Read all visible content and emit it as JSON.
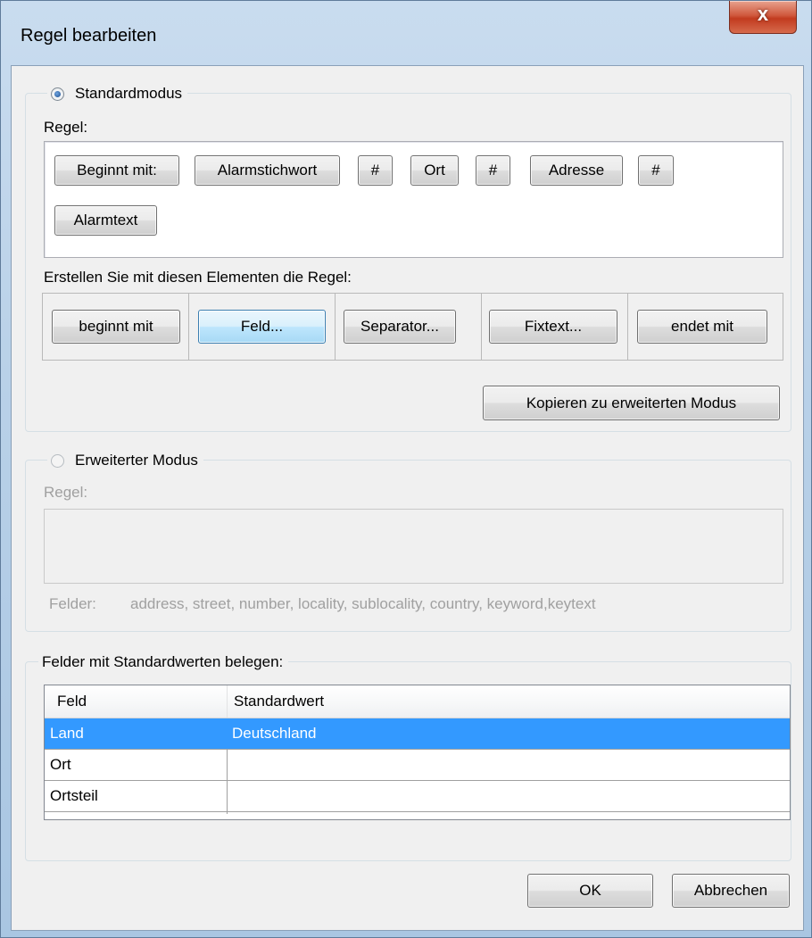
{
  "window": {
    "title": "Regel bearbeiten",
    "close_label": "x"
  },
  "standard_mode": {
    "radio_label": "Standardmodus",
    "selected": true,
    "rule_label": "Regel:",
    "rule_tokens": [
      "Beginnt mit:",
      "Alarmstichwort",
      "#",
      "Ort",
      "#",
      "Adresse",
      "#",
      "Alarmtext"
    ],
    "palette_label": "Erstellen Sie mit diesen Elementen die Regel:",
    "palette_buttons": [
      "beginnt mit",
      "Feld...",
      "Separator...",
      "Fixtext...",
      "endet mit"
    ],
    "copy_button": "Kopieren zu erweiterten Modus"
  },
  "advanced_mode": {
    "radio_label": "Erweiterter Modus",
    "selected": false,
    "rule_label": "Regel:",
    "fields_label": "Felder:",
    "fields_list": "address, street, number, locality, sublocality, country, keyword,keytext"
  },
  "defaults": {
    "group_label": "Felder mit Standardwerten belegen:",
    "columns": [
      "Feld",
      "Standardwert"
    ],
    "rows": [
      {
        "field": "Land",
        "value": "Deutschland",
        "selected": true
      },
      {
        "field": "Ort",
        "value": "",
        "selected": false
      },
      {
        "field": "Ortsteil",
        "value": "",
        "selected": false
      }
    ]
  },
  "footer": {
    "ok": "OK",
    "cancel": "Abbrechen"
  },
  "colors": {
    "selection": "#3399ff",
    "close_button": "#c23b1f"
  }
}
